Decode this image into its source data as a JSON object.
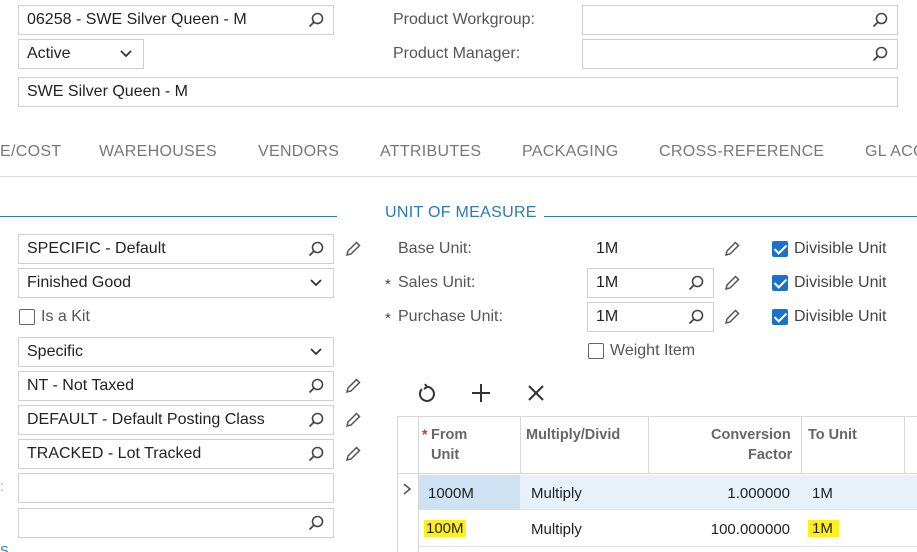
{
  "header": {
    "inventory_id": "06258 - SWE Silver Queen - M",
    "status": "Active",
    "description": "SWE Silver Queen - M",
    "product_workgroup_label": "Product Workgroup:",
    "product_workgroup_value": "",
    "product_manager_label": "Product Manager:",
    "product_manager_value": ""
  },
  "tabs": [
    "E/COST",
    "WAREHOUSES",
    "VENDORS",
    "ATTRIBUTES",
    "PACKAGING",
    "CROSS-REFERENCE",
    "GL ACC"
  ],
  "left": {
    "item_class": "SPECIFIC - Default",
    "type": "Finished Good",
    "is_kit_label": "Is a Kit",
    "valuation": "Specific",
    "tax_category": "NT - Not Taxed",
    "posting_class": "DEFAULT - Default Posting Class",
    "lot_class": "TRACKED - Lot Tracked",
    "field8": "",
    "field9": ""
  },
  "uom": {
    "section_title": "UNIT OF MEASURE",
    "base_unit_label": "Base Unit:",
    "base_unit_value": "1M",
    "sales_unit_label": "Sales Unit:",
    "sales_unit_value": "1M",
    "purchase_unit_label": "Purchase Unit:",
    "purchase_unit_value": "1M",
    "divisible_label": "Divisible Unit",
    "weight_item_label": "Weight Item",
    "required_mark": "*"
  },
  "grid": {
    "headers": {
      "from_unit": "From\nUnit",
      "from_unit_line1": "From",
      "from_unit_line2": "Unit",
      "multiply": "Multiply/Divid",
      "conversion_line1": "Conversion",
      "conversion_line2": "Factor",
      "to_unit": "To Unit"
    },
    "rows": [
      {
        "from": "1000M",
        "op": "Multiply",
        "factor": "1.000000",
        "to": "1M"
      },
      {
        "from": "100M",
        "op": "Multiply",
        "factor": "100.000000",
        "to": "1M"
      }
    ]
  },
  "colors": {
    "accent": "#1a73c8",
    "highlight": "#ffef1a",
    "selected_row": "#dbeaf7"
  },
  "icons": [
    "search-icon",
    "chevron-down-icon",
    "pencil-icon",
    "refresh-icon",
    "plus-icon",
    "close-icon",
    "row-arrow-icon"
  ]
}
